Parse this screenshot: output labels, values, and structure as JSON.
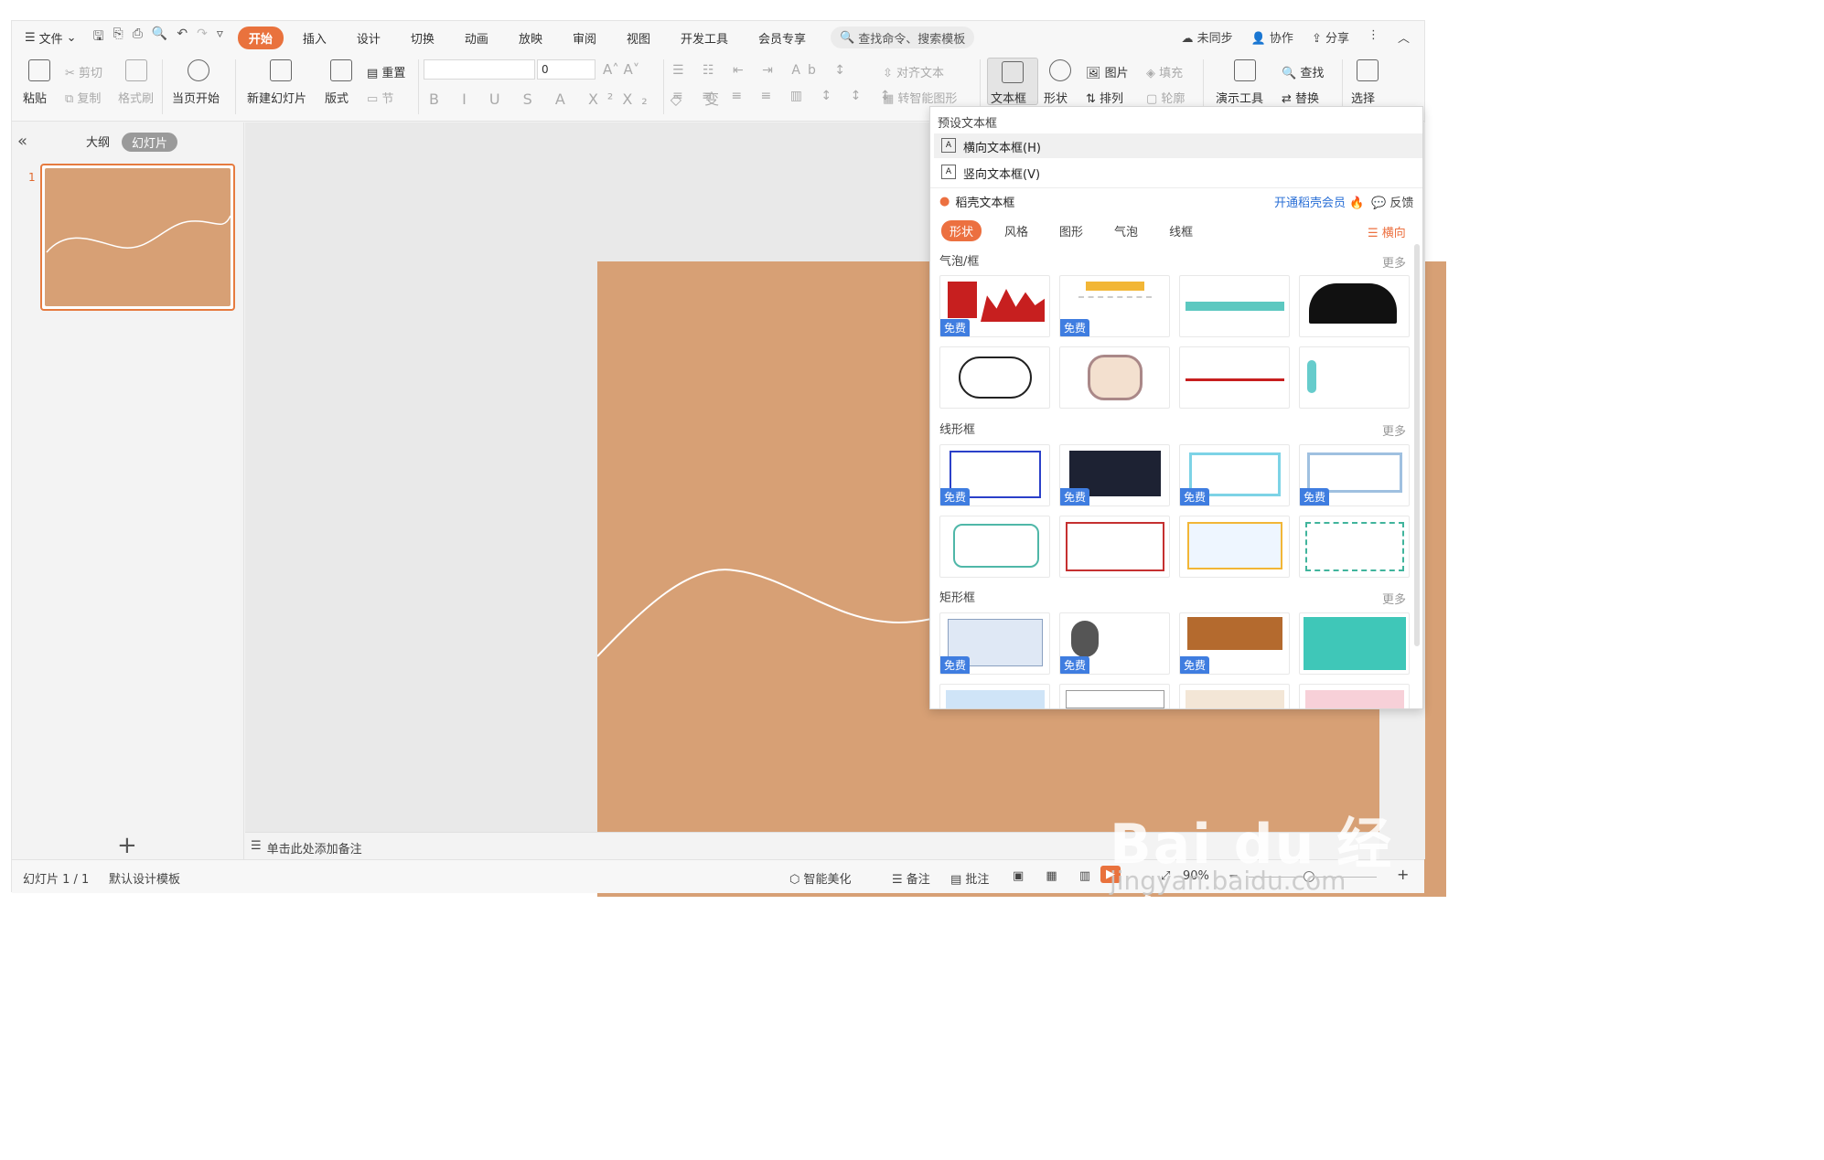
{
  "menubar": {
    "menu_label": "☰",
    "file": "文件",
    "tabs": [
      "开始",
      "插入",
      "设计",
      "切换",
      "动画",
      "放映",
      "审阅",
      "视图",
      "开发工具",
      "会员专享"
    ],
    "search": "查找命令、搜索模板",
    "right": [
      "未同步",
      "协作",
      "分享"
    ]
  },
  "ribbon": {
    "paste": "粘贴",
    "cut": "剪切",
    "copy": "复制",
    "format_painter": "格式刷",
    "play_current": "当页开始",
    "new_slide": "新建幻灯片",
    "layout": "版式",
    "reset": "重置",
    "section": "节",
    "font_size": "0",
    "align_text": "对齐文本",
    "smart_shape": "转智能图形",
    "textbox": "文本框",
    "shape": "形状",
    "arrange": "排列",
    "image": "图片",
    "fill": "填充",
    "outline": "轮廓",
    "presenter": "演示工具",
    "find": "查找",
    "replace": "替换",
    "select": "选择"
  },
  "leftpanel": {
    "collapse": "«",
    "tab_outline": "大纲",
    "tab_slides": "幻灯片",
    "slide_number": "1",
    "add": "+"
  },
  "notes": {
    "placeholder": "单击此处添加备注"
  },
  "statusbar": {
    "slide_info": "幻灯片 1 / 1",
    "template": "默认设计模板",
    "beautify": "智能美化",
    "notes": "备注",
    "comments": "批注",
    "zoom": "90%"
  },
  "dropdown": {
    "header": "预设文本框",
    "horizontal": "横向文本框(H)",
    "vertical": "竖向文本框(V)",
    "daoke": "稻壳文本框",
    "vip": "开通稻壳会员",
    "feedback": "反馈",
    "categories": [
      "形状",
      "风格",
      "图形",
      "气泡",
      "线框"
    ],
    "orientation": "横向",
    "sections": [
      "气泡/框",
      "线形框",
      "矩形框"
    ],
    "more": "更多",
    "free": "免费"
  },
  "watermark": {
    "main": "Bai du 经验",
    "sub": "jingyan.baidu.com"
  },
  "colors": {
    "accent": "#e9723d",
    "slide_bg": "#d7a075",
    "vip_blue": "#2a6fd6",
    "badge_blue": "#3f7de0"
  }
}
